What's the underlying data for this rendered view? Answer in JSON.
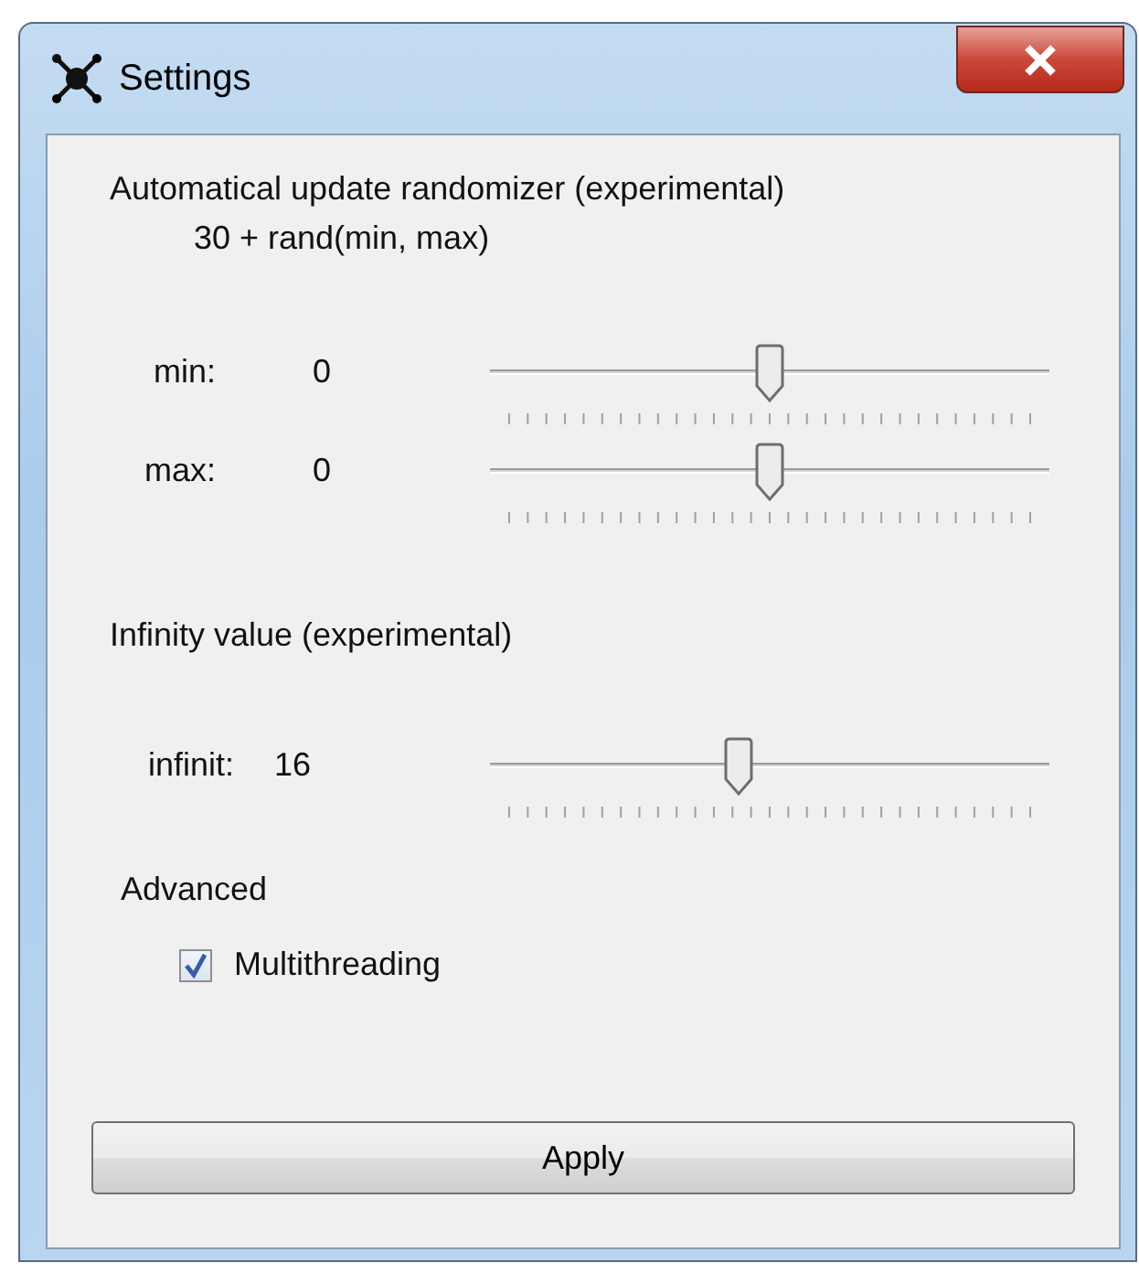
{
  "window": {
    "title": "Settings"
  },
  "sections": [
    {
      "heading": "Automatical update randomizer (experimental)",
      "formula": "30 + rand(min, max)",
      "sliders": [
        {
          "label": "min:",
          "value": "0",
          "level": 0.5
        },
        {
          "label": "max:",
          "value": "0",
          "level": 0.5
        }
      ]
    },
    {
      "heading": "Infinity value (experimental)",
      "sliders": [
        {
          "label": "infinit:",
          "value": "16",
          "level": 0.44
        }
      ]
    }
  ],
  "advanced": {
    "heading": "Advanced",
    "options": [
      {
        "label": "Multithreading",
        "checked": true
      }
    ]
  },
  "buttons": [
    "Apply"
  ]
}
